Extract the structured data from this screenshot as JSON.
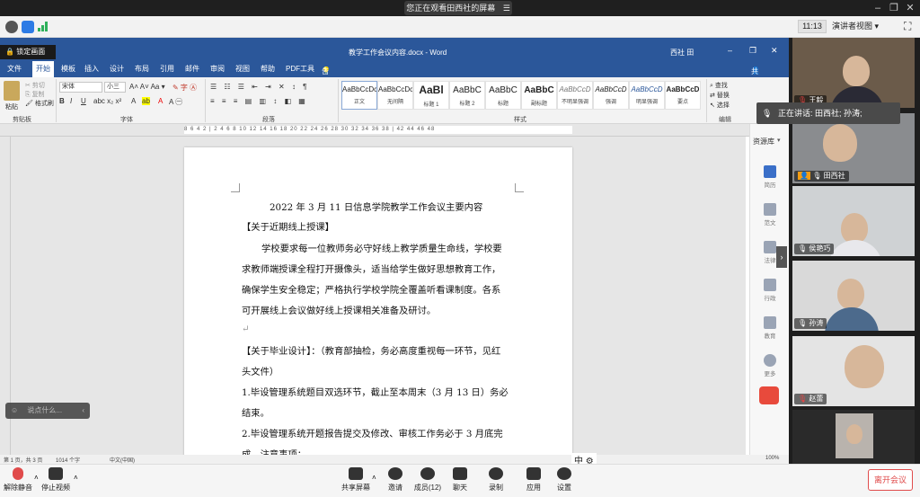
{
  "meeting": {
    "share_notice": "您正在观看田西社的屏幕",
    "time": "11:13",
    "view_mode": "演讲者视图",
    "speaking_label": "正在讲话: 田西社; 孙涛;",
    "leave_label": "离开会议",
    "chat_placeholder": "说点什么..."
  },
  "word": {
    "title": "教学工作会议内容.docx - Word",
    "user": "西社 田",
    "share_label": "共享",
    "lock_label": "锁定画面",
    "tabs": [
      "文件",
      "开始",
      "模板",
      "插入",
      "设计",
      "布局",
      "引用",
      "邮件",
      "审阅",
      "视图",
      "帮助",
      "PDF工具"
    ],
    "tell_me": "告诉我你想要做什么",
    "font_name": "宋体",
    "font_size": "小三",
    "groups": {
      "clipboard": "剪贴板",
      "font": "字体",
      "paragraph": "段落",
      "styles": "样式",
      "editing": "编辑"
    },
    "clipboard_items": {
      "paste": "粘贴",
      "cut": "剪切",
      "copy": "复制",
      "format_painter": "格式刷"
    },
    "editing_items": [
      "查找",
      "替换",
      "选择"
    ],
    "styles": [
      {
        "sample": "AaBbCcDc",
        "name": "正文"
      },
      {
        "sample": "AaBbCcDc",
        "name": "无间隔"
      },
      {
        "sample": "AaBl",
        "name": "标题 1"
      },
      {
        "sample": "AaBbC",
        "name": "标题 2"
      },
      {
        "sample": "AaBbC",
        "name": "标题"
      },
      {
        "sample": "AaBbC",
        "name": "副标题"
      },
      {
        "sample": "AaBbCcD",
        "name": "不明显强调"
      },
      {
        "sample": "AaBbCcD",
        "name": "强调"
      },
      {
        "sample": "AaBbCcD",
        "name": "明显强调"
      },
      {
        "sample": "AaBbCcD",
        "name": "要点"
      }
    ],
    "ruler_marks": "8 6 4 2 | 2 4 6 8 10 12 14 16 18 20 22 24 26 28 30 32 34 36 38 | 42 44 46 48",
    "side_panel": {
      "title": "资源库",
      "items": [
        "简历",
        "范文",
        "法律",
        "行政",
        "教育",
        "更多"
      ]
    },
    "status": {
      "page": "第 1 页，共 3 页",
      "words": "1014 个字",
      "lang": "中文(中国)",
      "zoom": "100%",
      "ime": "中"
    }
  },
  "doc": {
    "title": "2022 年 3 月 11 日信息学院教学工作会议主要内容",
    "h1": "【关于近期线上授课】",
    "p1_l1": "学校要求每一位教师务必守好线上教学质量生命线，学校要",
    "p1_l2": "求教师端授课全程打开摄像头，适当给学生做好思想教育工作，",
    "p1_l3": "确保学生安全稳定；严格执行学校学院全覆盖听看课制度。各系",
    "p1_l4": "可开展线上会议做好线上授课相关准备及研讨。",
    "h2_l1": "【关于毕业设计】：（教育部抽检，务必高度重视每一环节，见红",
    "h2_l2": "头文件）",
    "i1_l1": "1.毕设管理系统题目双选环节，截止至本周末（3 月 13 日）务必",
    "i1_l2": "结束。",
    "i2_l1": "2.毕设管理系统开题报告提交及修改、审核工作务必于 3 月底完",
    "i2_l2": "成，注意事项："
  },
  "participants": [
    {
      "name": "王毅"
    },
    {
      "name": "田西社"
    },
    {
      "name": "侯艳巧"
    },
    {
      "name": "孙涛"
    },
    {
      "name": "赵蕾"
    },
    {
      "name": ""
    }
  ],
  "toolbar": {
    "unmute": "解除静音",
    "stop_video": "停止视频",
    "share_screen": "共享屏幕",
    "invite": "邀请",
    "members": "成员(12)",
    "chat": "聊天",
    "record": "录制",
    "apps": "应用",
    "settings": "设置"
  }
}
